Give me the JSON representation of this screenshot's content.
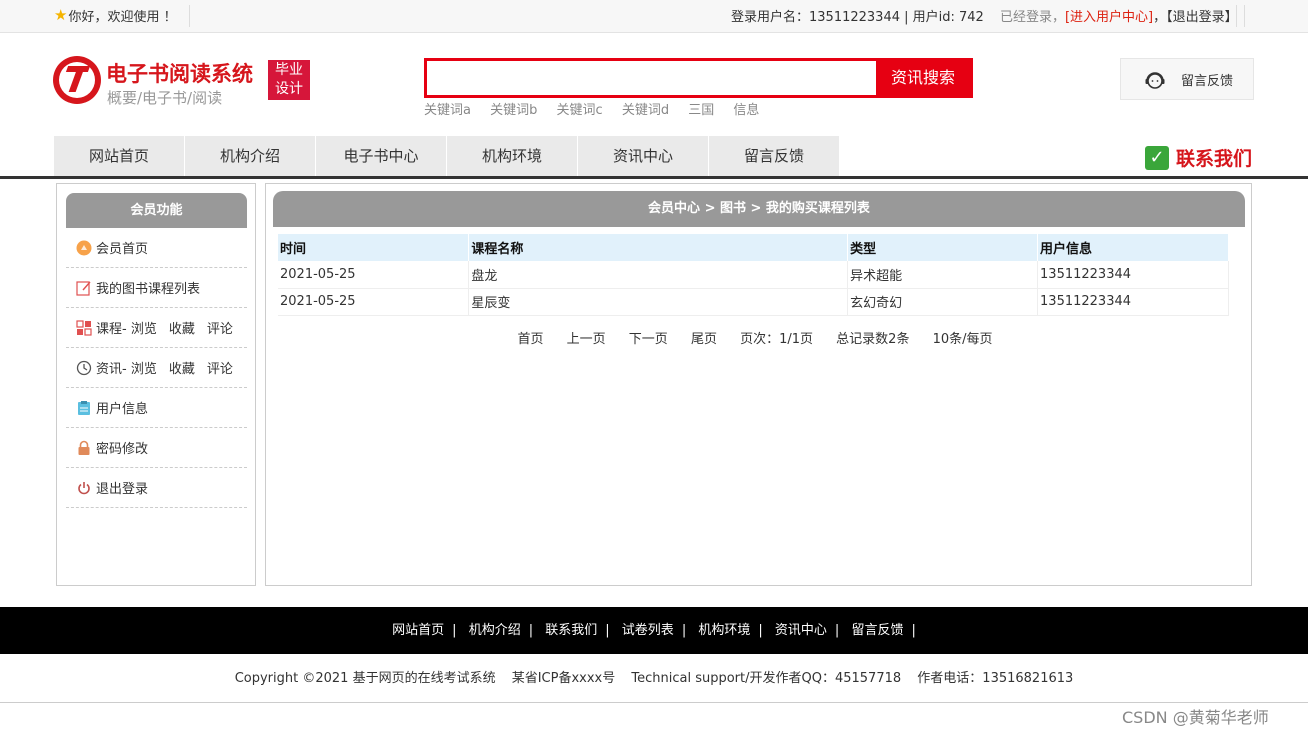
{
  "topbar": {
    "welcome": "你好，欢迎使用 ！",
    "login_user": "登录用户名：13511223344 | 用户id: 742",
    "logged_status": "已经登录，",
    "user_center_link": "[进入用户中心]",
    "separator": "，",
    "logout_link": "【退出登录】"
  },
  "header": {
    "title": "电子书阅读系统",
    "subtitle": "概要/电子书/阅读",
    "badge_line1": "毕业",
    "badge_line2": "设计",
    "search_placeholder": "",
    "search_button": "资讯搜索",
    "keywords": [
      "关键词a",
      "关键词b",
      "关键词c",
      "关键词d",
      "三国",
      "信息"
    ],
    "feedback_button": "留言反馈"
  },
  "nav": {
    "items": [
      "网站首页",
      "机构介绍",
      "电子书中心",
      "机构环境",
      "资讯中心",
      "留言反馈"
    ],
    "contact": "联系我们"
  },
  "sidebar": {
    "title": "会员功能",
    "items": [
      {
        "label": "会员首页",
        "extra": []
      },
      {
        "label": "我的图书课程列表",
        "extra": []
      },
      {
        "label": "课程- 浏览",
        "extra": [
          "收藏",
          "评论"
        ]
      },
      {
        "label": "资讯- 浏览",
        "extra": [
          "收藏",
          "评论"
        ]
      },
      {
        "label": "用户信息",
        "extra": []
      },
      {
        "label": "密码修改",
        "extra": []
      },
      {
        "label": "退出登录",
        "extra": []
      }
    ]
  },
  "main": {
    "breadcrumb": "会员中心 > 图书 > 我的购买课程列表",
    "table": {
      "headers": [
        "时间",
        "课程名称",
        "类型",
        "用户信息"
      ],
      "rows": [
        [
          "2021-05-25",
          "盘龙",
          "异术超能",
          "13511223344"
        ],
        [
          "2021-05-25",
          "星辰变",
          "玄幻奇幻",
          "13511223344"
        ]
      ]
    },
    "pager": {
      "first": "首页",
      "prev": "上一页",
      "next": "下一页",
      "last": "尾页",
      "page_info": "页次：1/1页",
      "total": "总记录数2条",
      "per_page": "10条/每页"
    }
  },
  "footer": {
    "links": [
      "网站首页",
      "机构介绍",
      "联系我们",
      "试卷列表",
      "机构环境",
      "资讯中心",
      "留言反馈"
    ],
    "link_sep": "|",
    "copyright": "Copyright ©2021 基于网页的在线考试系统",
    "icp": "某省ICP备xxxx号",
    "support": "Technical support/开发作者QQ：45157718",
    "phone": "作者电话：13516821613"
  },
  "watermark": "CSDN @黄菊华老师",
  "colors": {
    "brand_red": "#d6161c",
    "search_red": "#e60012",
    "panel_gray": "#999999",
    "table_header": "#e1f1fb"
  },
  "icons": {
    "sidebar": [
      "home-circle-icon",
      "edit-list-icon",
      "grid-icon",
      "clock-icon",
      "clipboard-icon",
      "lock-icon",
      "power-icon"
    ]
  }
}
